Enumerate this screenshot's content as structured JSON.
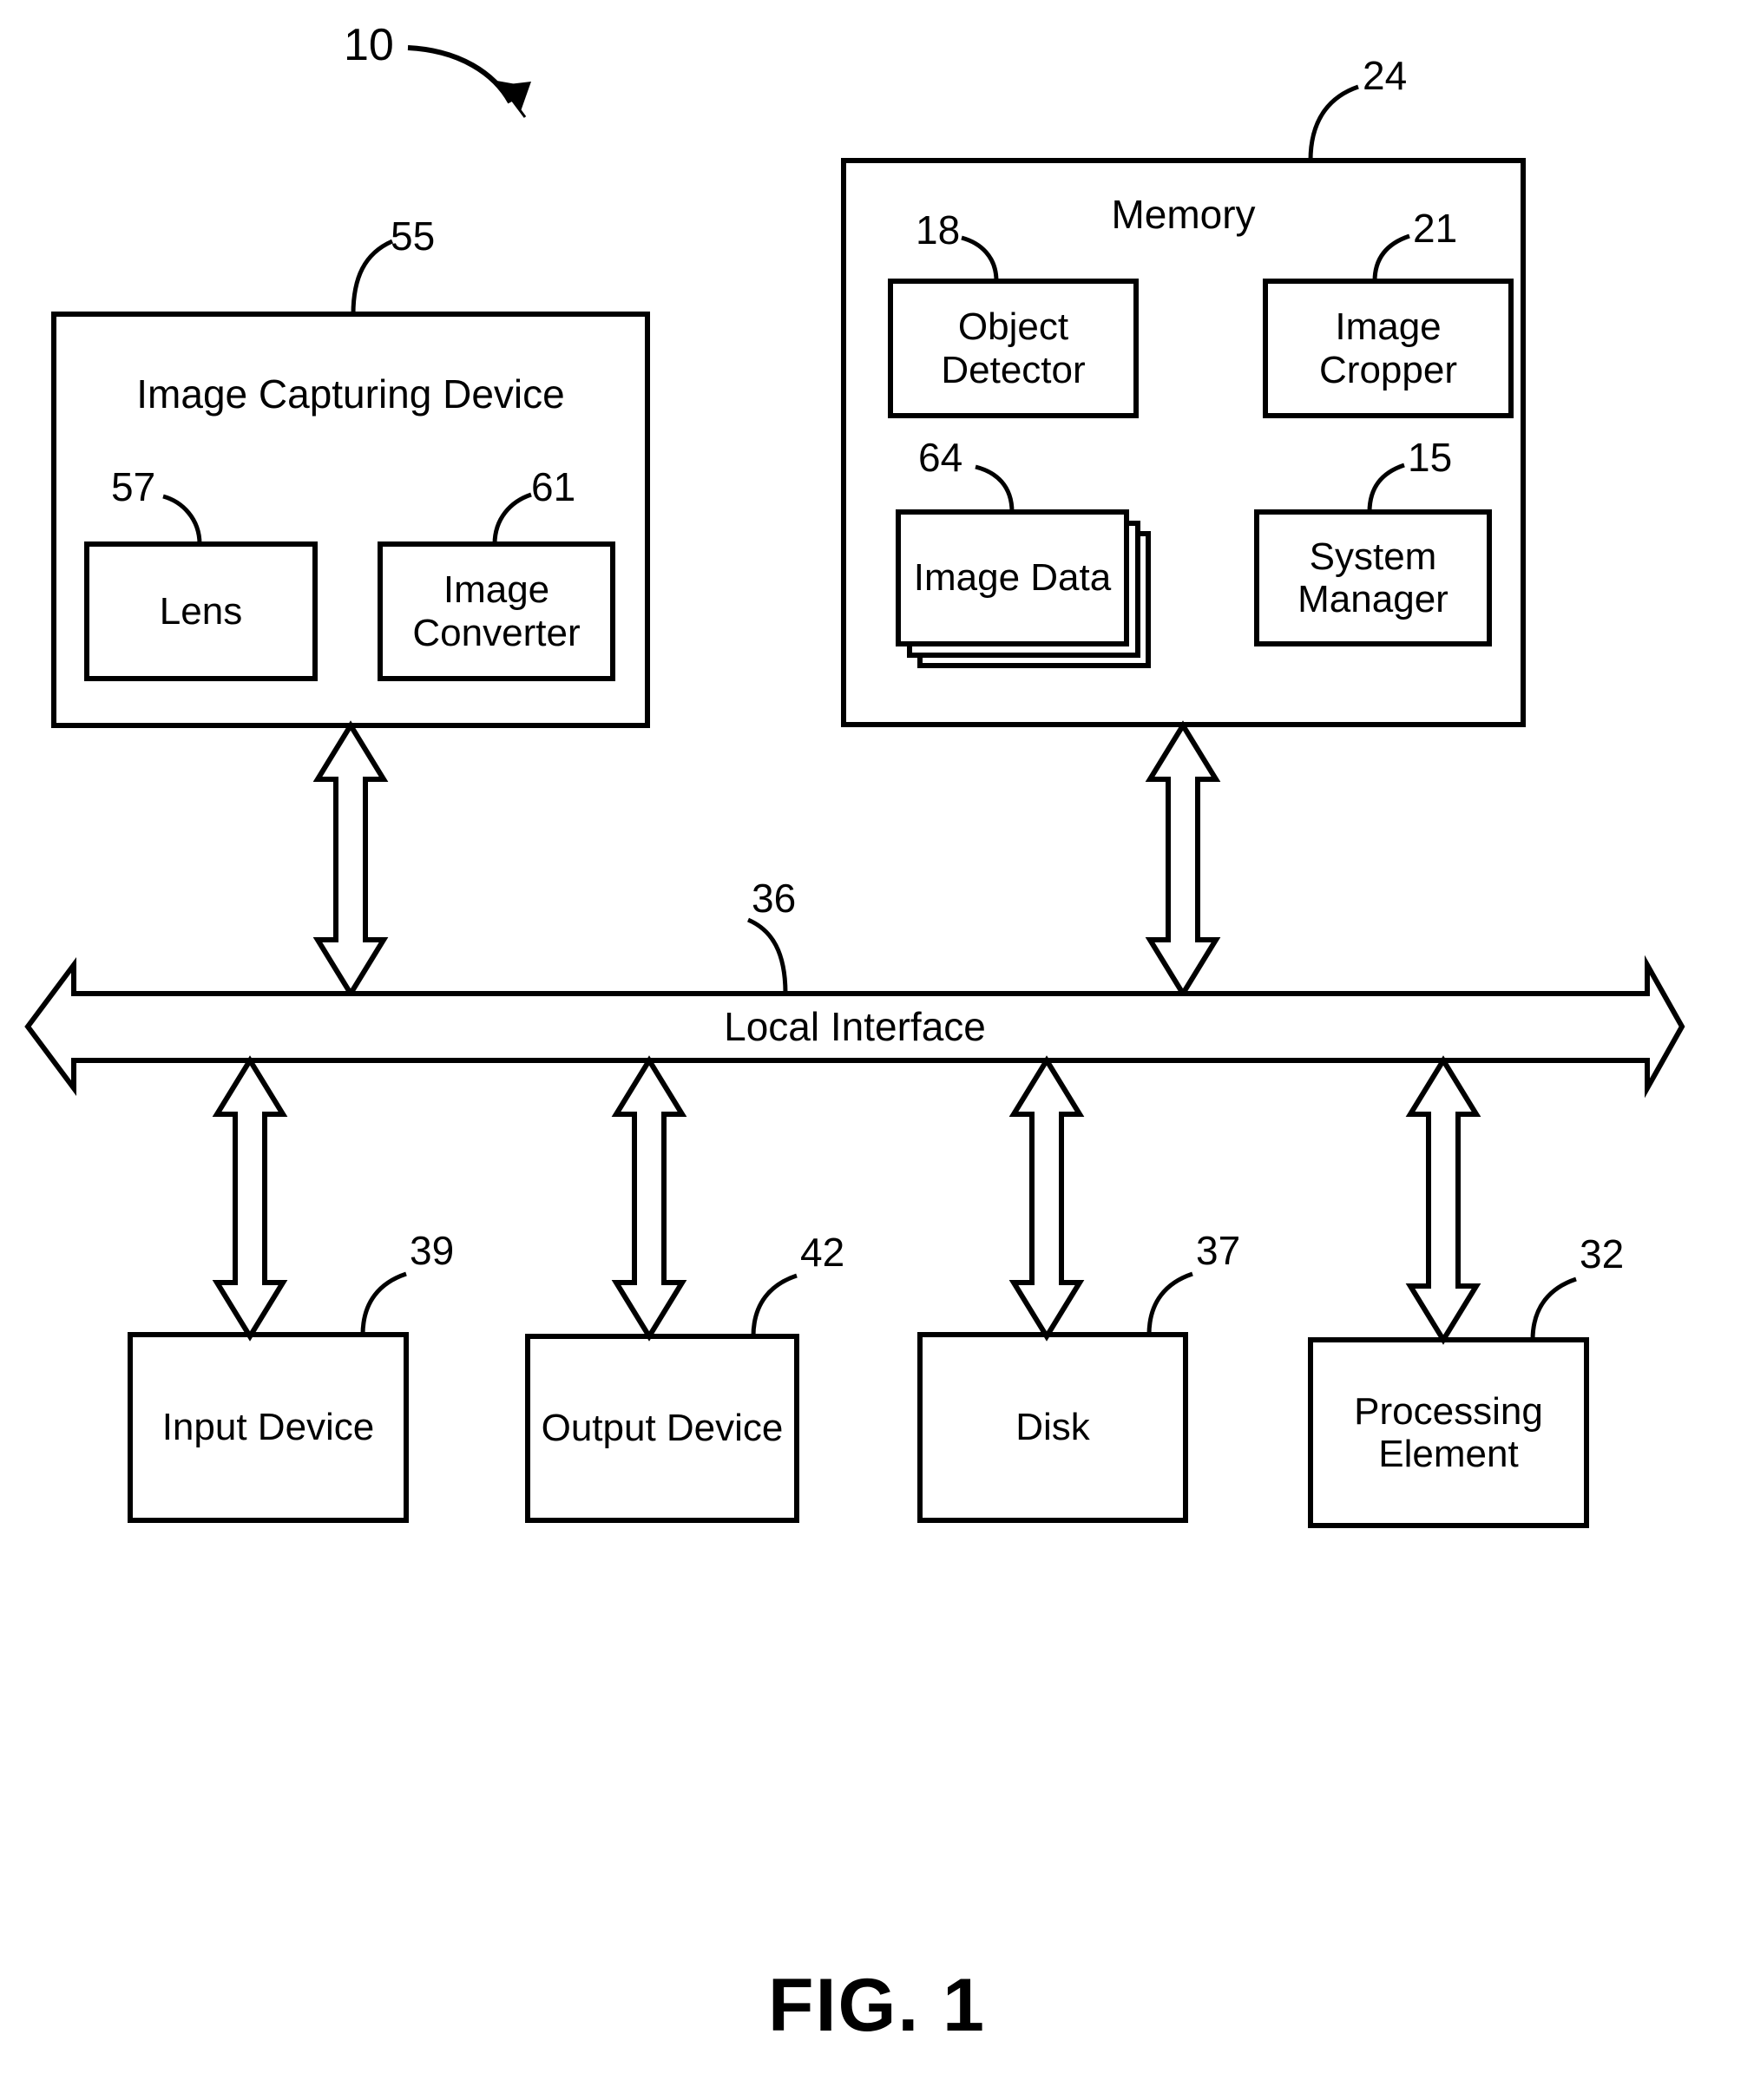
{
  "figure": {
    "caption": "FIG. 1",
    "system_ref": "10"
  },
  "blocks": {
    "image_capturing_device": {
      "label": "Image Capturing Device",
      "ref": "55",
      "children": [
        {
          "label": "Lens",
          "ref": "57"
        },
        {
          "label": "Image Converter",
          "ref": "61"
        }
      ]
    },
    "memory": {
      "label": "Memory",
      "ref": "24",
      "children": [
        {
          "label": "Object Detector",
          "ref": "18"
        },
        {
          "label": "Image Cropper",
          "ref": "21"
        },
        {
          "label": "Image Data",
          "ref": "64"
        },
        {
          "label": "System Manager",
          "ref": "15"
        }
      ]
    },
    "local_interface": {
      "label": "Local Interface",
      "ref": "36"
    },
    "peripherals": [
      {
        "label": "Input Device",
        "ref": "39"
      },
      {
        "label": "Output Device",
        "ref": "42"
      },
      {
        "label": "Disk",
        "ref": "37"
      },
      {
        "label": "Processing Element",
        "ref": "32"
      }
    ]
  },
  "icons": {
    "system_pointer": "curved-arrow-icon",
    "bus_arrow": "double-headed-arrow-icon"
  },
  "colors": {
    "ink": "#000000",
    "background": "#ffffff"
  }
}
